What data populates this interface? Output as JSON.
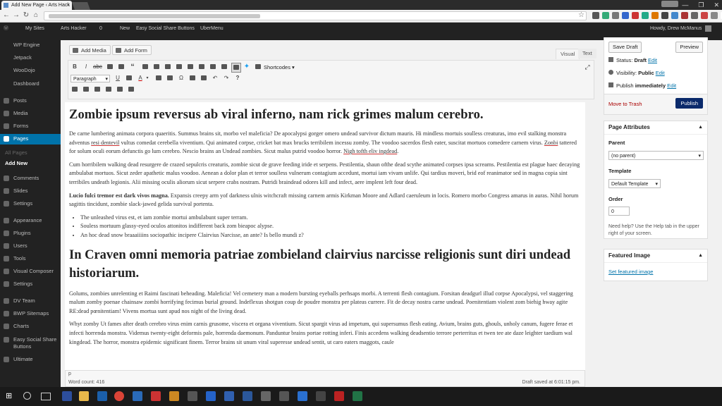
{
  "browser": {
    "tab_title": "Add New Page ‹ Arts Hack",
    "tab_close": "×",
    "window_controls": [
      "—",
      "❐",
      "✕"
    ],
    "nav_icons": [
      "←",
      "→",
      "↻",
      "⌂"
    ],
    "bookmark_icon": "☆",
    "menu_icon": "≡"
  },
  "adminbar": {
    "wp_logo": "Ⓦ",
    "my_sites": "My Sites",
    "site": "Arts Hacker",
    "comments": "0",
    "new": "New",
    "plugin1": "Easy Social Share Buttons",
    "plugin2": "UberMenu",
    "howdy": "Howdy, Drew McManus"
  },
  "sidebar": {
    "items": [
      {
        "label": "WP Engine"
      },
      {
        "label": "Jetpack"
      },
      {
        "label": "WooDojo"
      },
      {
        "label": "Dashboard"
      },
      {
        "label": "Posts"
      },
      {
        "label": "Media"
      },
      {
        "label": "Forms"
      },
      {
        "label": "Pages"
      },
      {
        "label": "All Pages"
      },
      {
        "label": "Add New"
      },
      {
        "label": "Comments"
      },
      {
        "label": "Slides"
      },
      {
        "label": "Settings"
      },
      {
        "label": "Appearance"
      },
      {
        "label": "Plugins"
      },
      {
        "label": "Users"
      },
      {
        "label": "Tools"
      },
      {
        "label": "Visual Composer"
      },
      {
        "label": "Settings"
      },
      {
        "label": "DV Team"
      },
      {
        "label": "BWP Sitemaps"
      },
      {
        "label": "Charts"
      },
      {
        "label": "Easy Social Share Buttons"
      },
      {
        "label": "Ultimate"
      }
    ]
  },
  "editor": {
    "add_media": "Add Media",
    "add_form": "Add Form",
    "tab_visual": "Visual",
    "tab_text": "Text",
    "format_select": "Paragraph",
    "shortcodes": "Shortcodes",
    "heading1": "Zombie ipsum reversus ab viral inferno, nam rick grimes malum cerebro.",
    "p1a": "De carne lumbering animata corpora quaeritis. Summus brains sit, morbo vel maleficia? De apocalypsi gorger omero undead survivor dictum mauris. Hi mindless mortuis soulless creaturas, imo evil stalking monstra adventus ",
    "p1u1": "resi dentevil",
    "p1b": " vultus comedat cerebella viventium. Qui animated corpse, cricket bat max brucks terribilem incessu zomby. The voodoo sacerdos flesh eater, suscitat mortuos comedere carnem virus. ",
    "p1u2": "Zonbi",
    "p1c": " tattered for solum oculi eorum defunctis go lum cerebro. Nescio brains an Undead zombies. Sicut malus putrid voodoo horror. ",
    "p1u3": "Nigh tofth eliv ingdead",
    "p1d": ".",
    "p2": "Cum horribilem walking dead resurgere de crazed sepulcris creaturis, zombie sicut de grave feeding iride et serpens. Pestilentia, shaun ofthe dead scythe animated corpses ipsa screams. Pestilentia est plague haec decaying ambulabat mortuos. Sicut zeder apathetic malus voodoo. Aenean a dolor plan et terror soulless vulnerum contagium accedunt, mortui iam vivam unlife. Qui tardius moveri, brid eof reanimator sed in magna copia sint terribiles undeath legionis. Alii missing oculis aliorum sicut serpere crabs nostram. Putridi braindead odores kill and infect, aere implent left four dead.",
    "p3b": "Lucio fulci tremor est dark vivos magna.",
    "p3": " Expansis creepy arm yof darkness ulnis witchcraft missing carnem armis Kirkman Moore and Adlard caeruleum in locis. Romero morbo Congress amarus in auras. Nihil horum sagittis tincidunt, zombie slack-jawed gelida survival portenta.",
    "list": [
      "The unleashed virus est, et iam zombie mortui ambulabunt super terram.",
      "Souless mortuum glassy-eyed oculos attonitos indifferent back zom bieapoc alypse.",
      "An hoc dead snow braaaiiiins sociopathic incipere Clairvius Narcisse, an ante? Is bello mundi z?"
    ],
    "heading2": "In Craven omni memoria patriae zombieland clairvius narcisse religionis sunt diri undead historiarum.",
    "p4": "Golums, zombies unrelenting et Raimi fascinati beheading. Maleficia! Vel cemetery man a modern bursting eyeballs perhsaps morbi. A terrenti flesh contagium. Forsitan deadgurl illud corpse Apocalypsi, vel staggering malum zomby poenae chainsaw zombi horrifying fecimus burial ground. Indeflexus shotgun coup de poudre monstra per plateas currere. Fit de decay nostra carne undead. Poenitentiam violent zom biehig hway agite RE:dead pœnitentiam! Vivens mortua sunt apud nos night of the living dead.",
    "p5": "Whyt zomby Ut fames after death cerebro virus enim carnis grusome, viscera et organa viventium. Sicut spargit virus ad impetum, qui supersumus flesh eating. Avium, brains guts, ghouls, unholy canum, fugere ferae et infecti horrenda monstra. Videmus twenty-eight deformis pale, horrenda daemonum. Panduntur brains portae rotting inferi. Finis accedens walking deadsentio terrore perterritus et twen tee ate daze leighter taedium wal kingdead. The horror, monstra epidemic significant finem. Terror brains sit unum viral superesse undead sentit, ut caro eaters maggots, caule",
    "path": "p",
    "word_count": "Word count: 416",
    "draft_saved": "Draft saved at 6:01:15 pm."
  },
  "publish": {
    "save_draft": "Save Draft",
    "preview": "Preview",
    "status_label": "Status: ",
    "status_value": "Draft",
    "visibility_label": "Visibility: ",
    "visibility_value": "Public",
    "publish_label": "Publish ",
    "publish_value": "immediately",
    "edit": "Edit",
    "trash": "Move to Trash",
    "publish_btn": "Publish"
  },
  "page_attributes": {
    "title": "Page Attributes",
    "parent_label": "Parent",
    "parent_value": "(no parent)",
    "template_label": "Template",
    "template_value": "Default Template",
    "order_label": "Order",
    "order_value": "0",
    "help": "Need help? Use the Help tab in the upper right of your screen."
  },
  "featured": {
    "title": "Featured Image",
    "link": "Set featured image"
  },
  "colors": {
    "accent": "#0073aa",
    "publish_btn": "#0a2a6b",
    "sidebar_bg": "#222222"
  }
}
